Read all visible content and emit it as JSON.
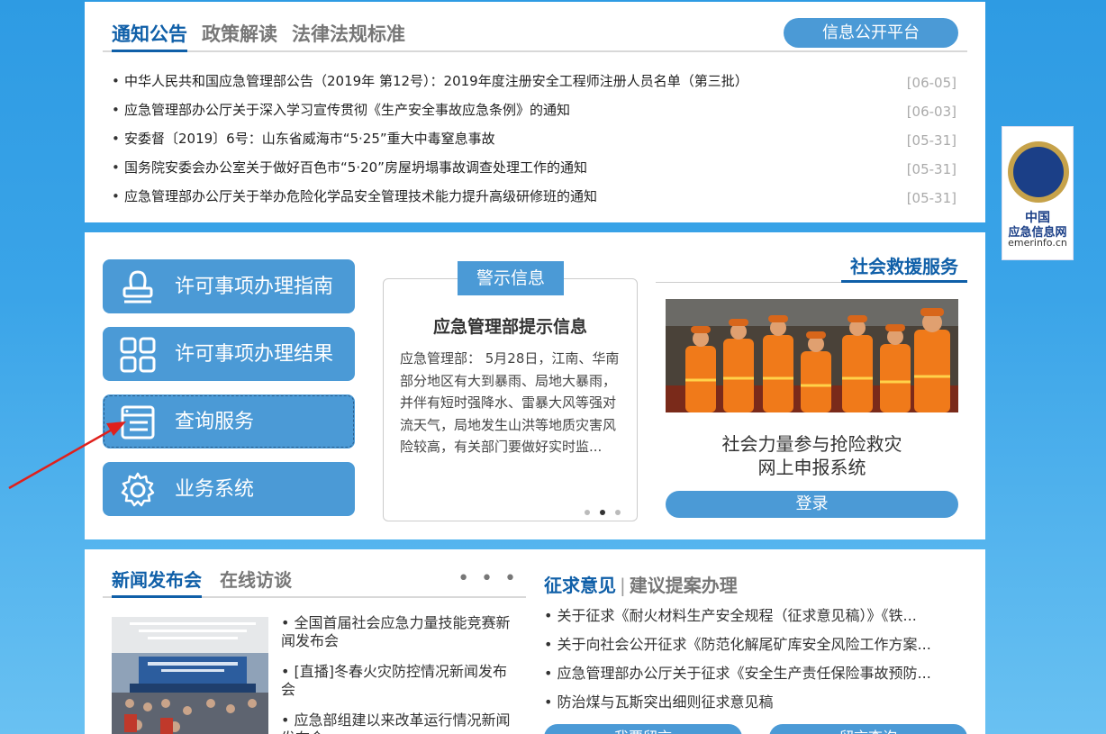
{
  "notices": {
    "tabs": [
      "通知公告",
      "政策解读",
      "法律法规标准"
    ],
    "platform_button": "信息公开平台",
    "items": [
      {
        "title": "中华人民共和国应急管理部公告（2019年 第12号）：2019年度注册安全工程师注册人员名单（第三批）",
        "date": "[06-05]"
      },
      {
        "title": "应急管理部办公厅关于深入学习宣传贯彻《生产安全事故应急条例》的通知",
        "date": "[06-03]"
      },
      {
        "title": "安委督〔2019〕6号：山东省威海市“5·25”重大中毒窒息事故",
        "date": "[05-31]"
      },
      {
        "title": "国务院安委会办公室关于做好百色市“5·20”房屋坍塌事故调查处理工作的通知",
        "date": "[05-31]"
      },
      {
        "title": "应急管理部办公厅关于举办危险化学品安全管理技术能力提升高级研修班的通知",
        "date": "[05-31]"
      }
    ]
  },
  "services": [
    {
      "label": "许可事项办理指南",
      "icon": "seal-icon"
    },
    {
      "label": "许可事项办理结果",
      "icon": "grid-icon"
    },
    {
      "label": "查询服务",
      "icon": "query-list-icon"
    },
    {
      "label": "业务系统",
      "icon": "gear-icon"
    }
  ],
  "warning": {
    "tag": "警示信息",
    "title": "应急管理部提示信息",
    "text": "应急管理部： 5月28日，江南、华南部分地区有大到暴雨、局地大暴雨，并伴有短时强降水、雷暴大风等强对流天气，局地发生山洪等地质灾害风险较高，有关部门要做好实时监..."
  },
  "rescue": {
    "title": "社会救援服务",
    "line1": "社会力量参与抢险救灾",
    "line2": "网上申报系统",
    "login": "登录"
  },
  "press": {
    "tabs": [
      "新闻发布会",
      "在线访谈"
    ],
    "more": "• • •",
    "items": [
      "• 全国首届社会应急力量技能竞赛新闻发布会",
      "• [直播]冬春火灾防控情况新闻发布会",
      "• 应急部组建以来改革运行情况新闻发布会"
    ]
  },
  "opinions": {
    "head": "征求意见",
    "sep": "|",
    "head2": "建议提案办理",
    "items": [
      "• 关于征求《耐火材料生产安全规程（征求意见稿）》《铁...",
      "• 关于向社会公开征求《防范化解尾矿库安全风险工作方案...",
      "• 应急管理部办公厅关于征求《安全生产责任保险事故预防...",
      "• 防治煤与瓦斯突出细则征求意见稿"
    ],
    "btn1": "我要留言",
    "btn2": "留言查询"
  },
  "badge": {
    "line1": "中国",
    "line2": "应急信息网",
    "line3": "emerinfo.cn"
  },
  "colors": {
    "accent": "#4b9ad6",
    "title_blue": "#0f5fa8",
    "background": "#3aa4e8"
  }
}
